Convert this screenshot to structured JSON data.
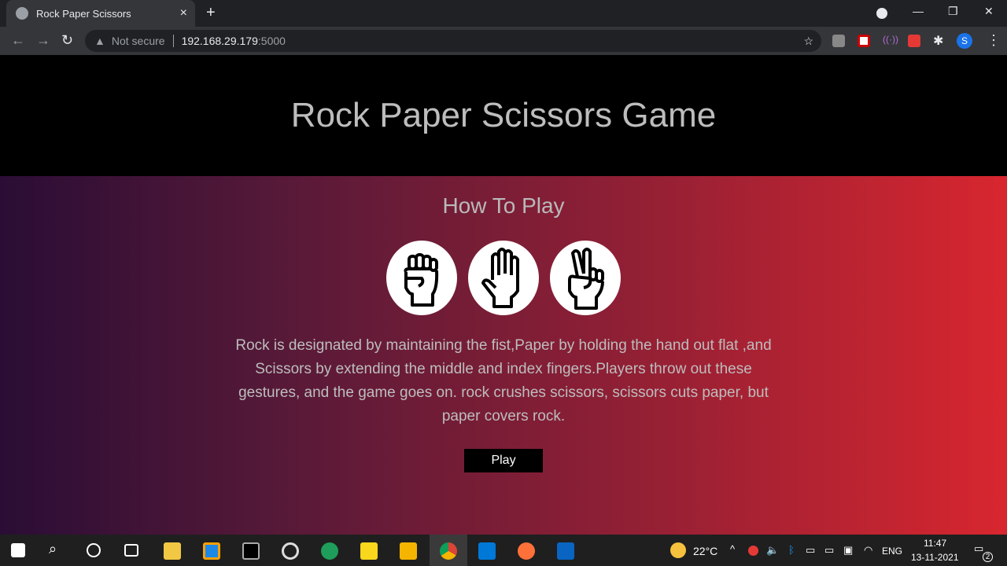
{
  "browser": {
    "tab_title": "Rock Paper Scissors",
    "new_tab": "+",
    "close": "×",
    "not_secure": "Not secure",
    "url_host": "192.168.29.179",
    "url_port": ":5000",
    "profile_initial": "S",
    "minimize": "—",
    "restore": "❐",
    "close_window": "✕"
  },
  "page": {
    "title": "Rock Paper Scissors Game",
    "subtitle": "How To Play",
    "description": "Rock is designated by maintaining the fist,Paper by holding the hand out flat ,and Scissors by extending the middle and index fingers.Players throw out these gestures, and the game goes on. rock crushes scissors, scissors cuts paper, but paper covers rock.",
    "play_label": "Play",
    "hands": [
      "rock",
      "paper",
      "scissors"
    ]
  },
  "taskbar": {
    "temperature": "22°C",
    "language": "ENG",
    "time": "11:47",
    "date": "13-11-2021",
    "notifications": "2"
  },
  "colors": {
    "gradient_start": "#2a0d35",
    "gradient_end": "#d8262f"
  }
}
